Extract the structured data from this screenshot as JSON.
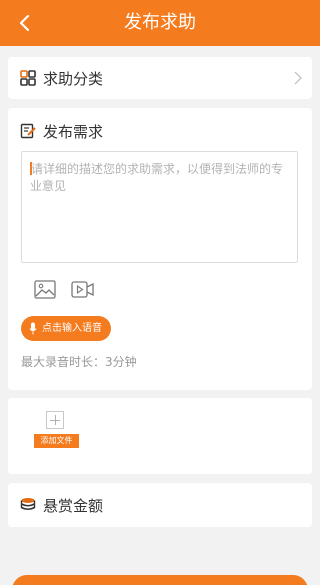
{
  "header": {
    "title": "发布求助"
  },
  "category": {
    "label": "求助分类"
  },
  "request": {
    "label": "发布需求",
    "placeholder": "请详细的描述您的求助需求，以便得到法师的专业意见",
    "voice_button": "点击输入语音",
    "voice_note": "最大录音时长：3分钟"
  },
  "files": {
    "add_label": "添加文件"
  },
  "reward": {
    "label": "悬赏金额"
  },
  "colors": {
    "accent": "#f47b1e",
    "background": "#f2f2f2",
    "card": "#ffffff"
  }
}
